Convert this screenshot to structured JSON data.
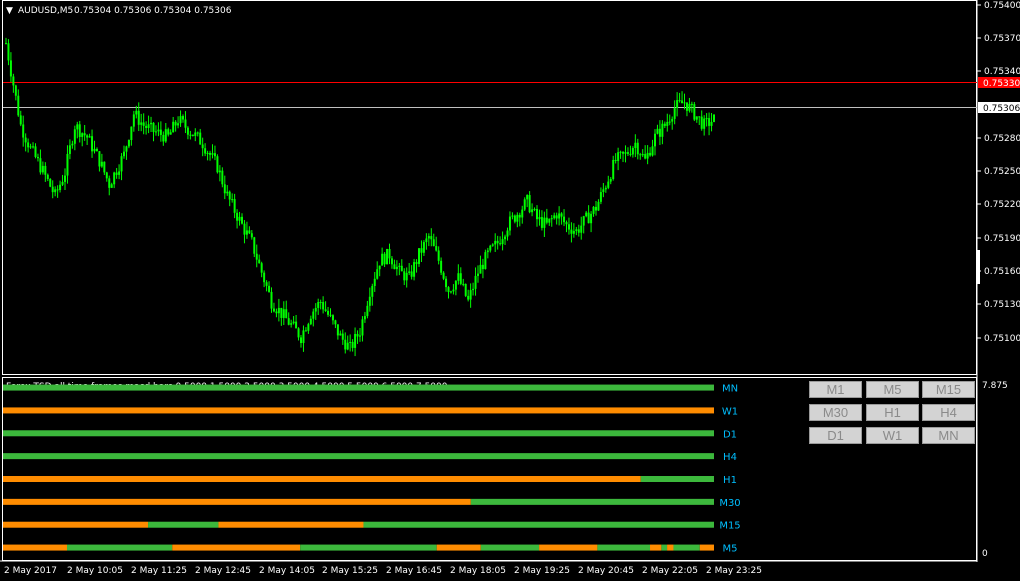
{
  "header": {
    "symbol": "AUDUSD,M5",
    "ohlc": "0.75304 0.75306 0.75304 0.75306"
  },
  "price_axis": {
    "ticks": [
      "0.75400",
      "0.75370",
      "0.75340",
      "0.75280",
      "0.75250",
      "0.75220",
      "0.75190",
      "0.75160",
      "0.75130",
      "0.75100"
    ],
    "ask_label": "0.75330",
    "bid_label": "0.75306",
    "ask_color": "#ff0000",
    "bid_color": "#c0c0c0"
  },
  "indicator": {
    "title": "Forex TSD all time frames macd bars 0.5000 1.5000 2.5000 3.5000 4.5000 5.5000 6.5000 7.5000",
    "axis_top": "7.875",
    "axis_bottom": "0",
    "label_color": "#00bfff",
    "up_color": "#3cb83c",
    "down_color": "#ff8c00"
  },
  "time_axis": {
    "labels": [
      "2 May 2017",
      "2 May 10:05",
      "2 May 11:25",
      "2 May 12:45",
      "2 May 14:05",
      "2 May 15:25",
      "2 May 16:45",
      "2 May 18:05",
      "2 May 19:25",
      "2 May 20:45",
      "2 May 22:05",
      "2 May 23:25"
    ]
  },
  "buttons": [
    "M1",
    "M5",
    "M15",
    "M30",
    "H1",
    "H4",
    "D1",
    "W1",
    "MN"
  ],
  "chart_data": [
    {
      "type": "candlestick",
      "title": "AUDUSD,M5",
      "ylim": [
        0.7509,
        0.75405
      ],
      "bull_color": "#00ff00",
      "bear_color": "#00ff00",
      "approx_close_path": [
        [
          0,
          0.7537
        ],
        [
          3,
          0.75335
        ],
        [
          6,
          0.753
        ],
        [
          10,
          0.7528
        ],
        [
          14,
          0.75265
        ],
        [
          20,
          0.7524
        ],
        [
          24,
          0.7526
        ],
        [
          28,
          0.753
        ],
        [
          33,
          0.7529
        ],
        [
          38,
          0.7527
        ],
        [
          42,
          0.7525
        ],
        [
          48,
          0.75275
        ],
        [
          52,
          0.7531
        ],
        [
          56,
          0.753
        ],
        [
          60,
          0.75295
        ],
        [
          66,
          0.7529
        ],
        [
          70,
          0.75305
        ],
        [
          75,
          0.75295
        ],
        [
          80,
          0.75285
        ],
        [
          86,
          0.75265
        ],
        [
          90,
          0.7524
        ],
        [
          96,
          0.75215
        ],
        [
          100,
          0.752
        ],
        [
          104,
          0.75175
        ],
        [
          108,
          0.7515
        ],
        [
          112,
          0.7514
        ],
        [
          116,
          0.7513
        ],
        [
          120,
          0.7512
        ],
        [
          124,
          0.7514
        ],
        [
          128,
          0.7515
        ],
        [
          132,
          0.75135
        ],
        [
          136,
          0.7512
        ],
        [
          140,
          0.7511
        ],
        [
          144,
          0.75125
        ],
        [
          148,
          0.7516
        ],
        [
          152,
          0.75185
        ],
        [
          156,
          0.7519
        ],
        [
          160,
          0.75175
        ],
        [
          164,
          0.7517
        ],
        [
          168,
          0.7519
        ],
        [
          172,
          0.75205
        ],
        [
          176,
          0.75185
        ],
        [
          180,
          0.7516
        ],
        [
          184,
          0.7517
        ],
        [
          188,
          0.7515
        ],
        [
          192,
          0.75175
        ],
        [
          196,
          0.7519
        ],
        [
          200,
          0.752
        ],
        [
          204,
          0.75215
        ],
        [
          208,
          0.75225
        ],
        [
          212,
          0.75235
        ],
        [
          216,
          0.7522
        ],
        [
          220,
          0.75215
        ],
        [
          224,
          0.75225
        ],
        [
          228,
          0.75215
        ],
        [
          232,
          0.7521
        ],
        [
          236,
          0.7522
        ],
        [
          240,
          0.7523
        ],
        [
          244,
          0.7525
        ],
        [
          248,
          0.7527
        ],
        [
          252,
          0.75275
        ],
        [
          256,
          0.75285
        ],
        [
          260,
          0.7527
        ],
        [
          264,
          0.7529
        ],
        [
          268,
          0.753
        ],
        [
          272,
          0.75315
        ],
        [
          276,
          0.7532
        ],
        [
          280,
          0.7531
        ],
        [
          284,
          0.753
        ],
        [
          288,
          0.75305
        ]
      ]
    },
    {
      "type": "bar",
      "title": "Forex TSD all time frames macd bars 0.5000 1.5000 2.5000 3.5000 4.5000 5.5000 6.5000 7.5000",
      "ylim": [
        0,
        7.875
      ],
      "rows": [
        {
          "name": "MN",
          "level": 7.5,
          "segments": [
            [
              0,
              1,
              "up"
            ]
          ]
        },
        {
          "name": "W1",
          "level": 6.5,
          "segments": [
            [
              0,
              1,
              "down"
            ]
          ]
        },
        {
          "name": "D1",
          "level": 5.5,
          "segments": [
            [
              0,
              1,
              "up"
            ]
          ]
        },
        {
          "name": "H4",
          "level": 4.5,
          "segments": [
            [
              0,
              1,
              "up"
            ]
          ]
        },
        {
          "name": "H1",
          "level": 3.5,
          "segments": [
            [
              0,
              0.897,
              "down"
            ],
            [
              0.897,
              1,
              "up"
            ]
          ]
        },
        {
          "name": "M30",
          "level": 2.5,
          "segments": [
            [
              0,
              0.658,
              "down"
            ],
            [
              0.658,
              1,
              "up"
            ]
          ]
        },
        {
          "name": "M15",
          "level": 1.5,
          "segments": [
            [
              0,
              0.204,
              "down"
            ],
            [
              0.204,
              0.303,
              "up"
            ],
            [
              0.303,
              0.507,
              "down"
            ],
            [
              0.507,
              1,
              "up"
            ]
          ]
        },
        {
          "name": "M5",
          "level": 0.5,
          "segments": [
            [
              0,
              0.09,
              "down"
            ],
            [
              0.09,
              0.238,
              "up"
            ],
            [
              0.238,
              0.418,
              "down"
            ],
            [
              0.418,
              0.61,
              "up"
            ],
            [
              0.61,
              0.672,
              "down"
            ],
            [
              0.672,
              0.754,
              "up"
            ],
            [
              0.754,
              0.836,
              "down"
            ],
            [
              0.836,
              0.91,
              "up"
            ],
            [
              0.91,
              0.926,
              "down"
            ],
            [
              0.926,
              0.934,
              "up"
            ],
            [
              0.934,
              0.943,
              "down"
            ],
            [
              0.943,
              0.98,
              "up"
            ],
            [
              0.98,
              1,
              "down"
            ]
          ]
        }
      ]
    }
  ]
}
